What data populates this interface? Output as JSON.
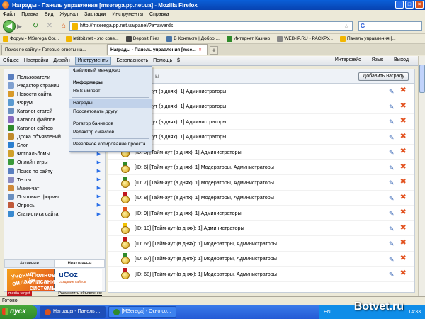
{
  "window": {
    "title": "Награды - Панель управления [mserega.pp.net.ua] - Mozilla Firefox"
  },
  "menubar": [
    "Файл",
    "Правка",
    "Вид",
    "Журнал",
    "Закладки",
    "Инструменты",
    "Справка"
  ],
  "navbar": {
    "url": "http://mserega.pp.net.ua/panel/?a=awards"
  },
  "bookmarks": [
    {
      "label": "Форум - MSerega Cor...",
      "color": "#f2b600"
    },
    {
      "label": "letitbit.net - это сове...",
      "color": "#f2b600"
    },
    {
      "label": "Deposit Files",
      "color": "#444444"
    },
    {
      "label": "В Контакте | Добро ...",
      "color": "#4a76a8"
    },
    {
      "label": "Интернет Казино",
      "color": "#2f8a2a"
    },
    {
      "label": "WEB-IP.RU - РАСКРУ...",
      "color": "#888888"
    },
    {
      "label": "Панель управления [...",
      "color": "#f2b600"
    }
  ],
  "tabs": [
    {
      "label": "Поиск по сайту » Готовые ответы на..."
    },
    {
      "label": "Награды - Панель управления [mse..."
    }
  ],
  "admin": {
    "menu": [
      "Общее",
      "Настройки",
      "Дизайн",
      "Инструменты",
      "Безопасность",
      "Помощь",
      "$"
    ],
    "right": [
      "Интерфейс",
      "Язык",
      "Выход"
    ]
  },
  "dropdown": [
    "Файловый менеджер",
    "Информеры",
    "RSS импорт",
    "Награды",
    "Посоветовать другу",
    "Ротатор баннеров",
    "Редактор смайлов",
    "Резервное копирование проекта"
  ],
  "sidebar": {
    "items": [
      {
        "label": "Пользователи",
        "color": "#5a7fc0",
        "arrow": false
      },
      {
        "label": "Редактор страниц",
        "color": "#7fa0d0",
        "arrow": false
      },
      {
        "label": "Новости сайта",
        "color": "#d89a2a",
        "arrow": false
      },
      {
        "label": "Форум",
        "color": "#5a9ad0",
        "arrow": false
      },
      {
        "label": "Каталог статей",
        "color": "#6a8fc0",
        "arrow": true
      },
      {
        "label": "Каталог файлов",
        "color": "#8a6ac0",
        "arrow": true
      },
      {
        "label": "Каталог сайтов",
        "color": "#2f8a2a",
        "arrow": true
      },
      {
        "label": "Доска объявлений",
        "color": "#c08a2a",
        "arrow": true
      },
      {
        "label": "Блог",
        "color": "#2a7fd0",
        "arrow": true
      },
      {
        "label": "Фотоальбомы",
        "color": "#d0a02a",
        "arrow": true
      },
      {
        "label": "Онлайн игры",
        "color": "#3a9a3a",
        "arrow": true
      },
      {
        "label": "Поиск по сайту",
        "color": "#5a7fc0",
        "arrow": true
      },
      {
        "label": "Тесты",
        "color": "#8a8ac0",
        "arrow": true
      },
      {
        "label": "Мини-чат",
        "color": "#d08a3a",
        "arrow": true
      },
      {
        "label": "Почтовые формы",
        "color": "#6a8fc0",
        "arrow": true
      },
      {
        "label": "Опросы",
        "color": "#c05a3a",
        "arrow": true
      },
      {
        "label": "Статистика сайта",
        "color": "#3a8ad0",
        "arrow": true
      }
    ],
    "tabs": [
      "Активные",
      "Неактивные"
    ],
    "promo": {
      "left": "Учение онлайн",
      "right_logo": "uCoz",
      "right_sub": "создание сайтов",
      "big": "Полное описание системы"
    },
    "media": {
      "logo": "media target",
      "link": "Разместить объявление"
    }
  },
  "main": {
    "add_button": "Добавить награду",
    "awards": [
      {
        "text": "[Тайм-аут (в днях): 1]  Администраторы",
        "ribbon": "#d8a20f"
      },
      {
        "text": "[Тайм-аут (в днях): 1]  Администраторы",
        "ribbon": "#d8a20f"
      },
      {
        "text": "[Тайм-аут (в днях): 1]  Администраторы",
        "ribbon": "#d8a20f"
      },
      {
        "text": "[Тайм-аут (в днях): 1]  Администраторы",
        "ribbon": "#d8a20f"
      },
      {
        "text": "[ID: 5]  [Тайм-аут (в днях): 1]  Администраторы",
        "ribbon": "#d8a20f"
      },
      {
        "text": "[ID: 6]  [Тайм-аут (в днях): 1]  Модераторы, Администраторы",
        "ribbon": "#2f8a2a"
      },
      {
        "text": "[ID: 7]  [Тайм-аут (в днях): 1]  Модераторы, Администраторы",
        "ribbon": "#2f8a2a"
      },
      {
        "text": "[ID: 8]  [Тайм-аут (в днях): 1]  Модераторы, Администраторы",
        "ribbon": "#c0151e"
      },
      {
        "text": "[ID: 9]  [Тайм-аут (в днях): 1]  Администраторы",
        "ribbon": "#e2511e"
      },
      {
        "text": "[ID: 10]  [Тайм-аут (в днях): 1]  Администраторы",
        "ribbon": "#f2c200"
      },
      {
        "text": "[ID: 66]  [Тайм-аут (в днях): 1]  Модераторы, Администраторы",
        "ribbon": "#c0151e"
      },
      {
        "text": "[ID: 67]  [Тайм-аут (в днях): 1]  Модераторы, Администраторы",
        "ribbon": "#2f8a2a"
      },
      {
        "text": "[ID: 68]  [Тайм-аут (в днях): 1]  Модераторы, Администраторы",
        "ribbon": "#c0151e"
      }
    ]
  },
  "status": "Готово",
  "taskbar": {
    "start": "пуск",
    "tasks": [
      {
        "label": "Награды - Панель ...",
        "active": true
      },
      {
        "label": "[MSerega] - Окно со...",
        "active": false
      }
    ],
    "lang": "EN",
    "time": "14:33"
  },
  "watermark": "Botvet.ru"
}
